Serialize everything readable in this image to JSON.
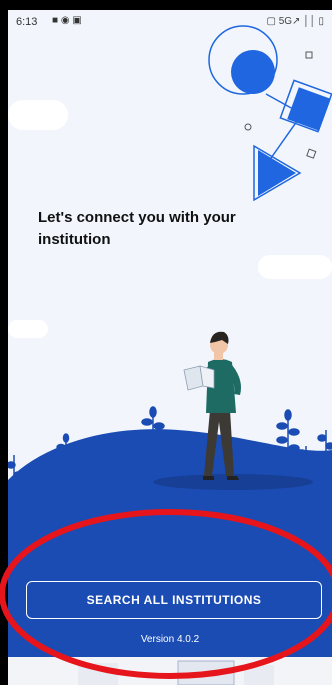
{
  "status_bar": {
    "time": "6:13",
    "left_icons": "■ ◉ ▣",
    "right_text": "▢ 5G↗ ││ ▯"
  },
  "headline": "Let's connect you with your institution",
  "search_button_label": "SEARCH ALL INSTITUTIONS",
  "version_label": "Version 4.0.2",
  "colors": {
    "brand_blue": "#1b4cb4",
    "accent_blue": "#1f66e0",
    "background": "#f2f6fc",
    "annotation_red": "#e5151b"
  },
  "icons": [
    "message-icon",
    "chat-icon",
    "gallery-icon",
    "signal-icon",
    "battery-icon"
  ]
}
